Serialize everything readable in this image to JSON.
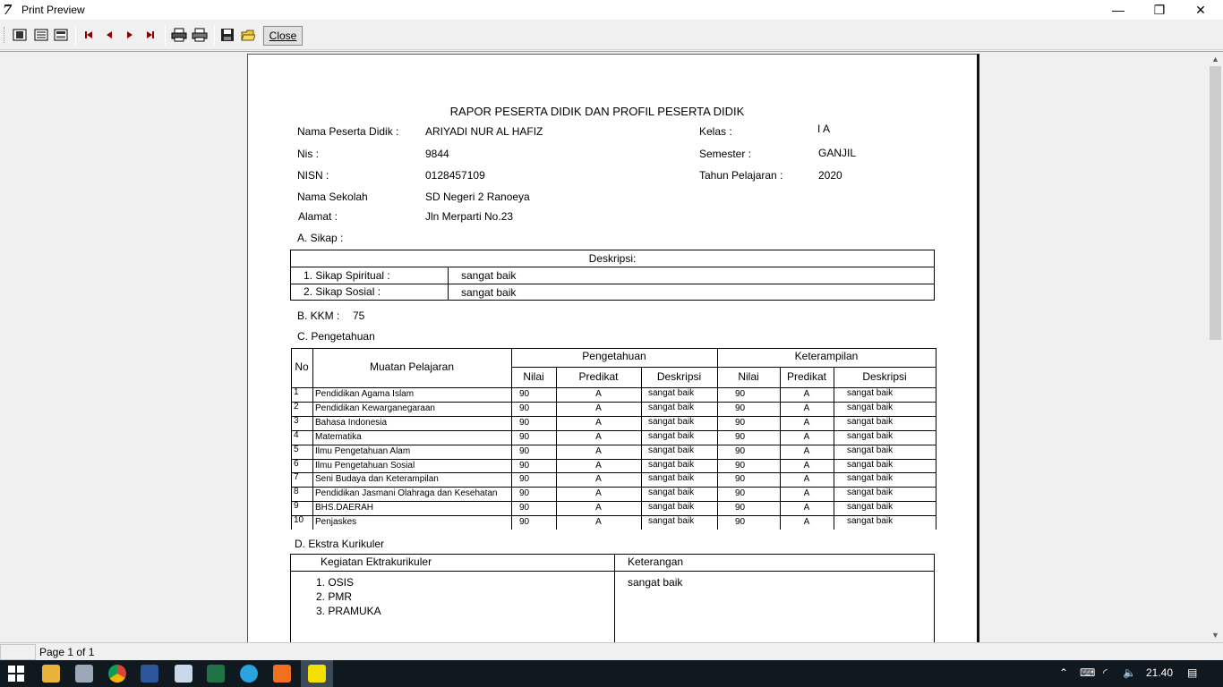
{
  "window": {
    "title": "Print Preview",
    "minimize": "—",
    "restore": "❐",
    "close": "✕"
  },
  "toolbar": {
    "close_label": "Close"
  },
  "report": {
    "title": "RAPOR PESERTA DIDIK DAN PROFIL PESERTA DIDIK",
    "labels": {
      "nama": "Nama Peserta Didik :",
      "nis": "Nis :",
      "nisn": "NISN :",
      "sekolah": "Nama Sekolah",
      "alamat": "Alamat :",
      "kelas": "Kelas :",
      "semester": "Semester :",
      "tahun": "Tahun Pelajaran :"
    },
    "values": {
      "nama": "ARIYADI NUR AL HAFIZ",
      "nis": "9844",
      "nisn": "0128457109",
      "sekolah": "SD Negeri 2 Ranoeya",
      "alamat": "Jln Merparti No.23",
      "kelas": "I A",
      "semester": "GANJIL",
      "tahun": "2020"
    },
    "sikap": {
      "heading": "A. Sikap :",
      "table_header": "Deskripsi:",
      "rows": [
        {
          "label": "1. Sikap Spiritual :",
          "value": "sangat baik"
        },
        {
          "label": "2. Sikap Sosial :",
          "value": "sangat baik"
        }
      ]
    },
    "kkm": {
      "label": "B. KKM :",
      "value": "75"
    },
    "pengetahuan": {
      "heading": "C. Pengetahuan",
      "headers": {
        "no": "No",
        "muatan": "Muatan Pelajaran",
        "pengetahuan": "Pengetahuan",
        "keterampilan": "Keterampilan",
        "nilai": "Nilai",
        "predikat": "Predikat",
        "deskripsi": "Deskripsi"
      },
      "rows": [
        {
          "no": "1",
          "mapel": "Pendidikan Agama Islam",
          "n1": "90",
          "p1": "A",
          "d1": "sangat baik",
          "n2": "90",
          "p2": "A",
          "d2": "sangat baik"
        },
        {
          "no": "2",
          "mapel": "Pendidikan Kewarganegaraan",
          "n1": "90",
          "p1": "A",
          "d1": "sangat baik",
          "n2": "90",
          "p2": "A",
          "d2": "sangat baik"
        },
        {
          "no": "3",
          "mapel": "Bahasa Indonesia",
          "n1": "90",
          "p1": "A",
          "d1": "sangat baik",
          "n2": "90",
          "p2": "A",
          "d2": "sangat baik"
        },
        {
          "no": "4",
          "mapel": "Matematika",
          "n1": "90",
          "p1": "A",
          "d1": "sangat baik",
          "n2": "90",
          "p2": "A",
          "d2": "sangat baik"
        },
        {
          "no": "5",
          "mapel": "Ilmu Pengetahuan Alam",
          "n1": "90",
          "p1": "A",
          "d1": "sangat baik",
          "n2": "90",
          "p2": "A",
          "d2": "sangat baik"
        },
        {
          "no": "6",
          "mapel": "Ilmu Pengetahuan Sosial",
          "n1": "90",
          "p1": "A",
          "d1": "sangat baik",
          "n2": "90",
          "p2": "A",
          "d2": "sangat baik"
        },
        {
          "no": "7",
          "mapel": "Seni Budaya dan Keterampilan",
          "n1": "90",
          "p1": "A",
          "d1": "sangat baik",
          "n2": "90",
          "p2": "A",
          "d2": "sangat baik"
        },
        {
          "no": "8",
          "mapel": "Pendidikan Jasmani Olahraga dan Kesehatan",
          "n1": "90",
          "p1": "A",
          "d1": "sangat baik",
          "n2": "90",
          "p2": "A",
          "d2": "sangat baik"
        },
        {
          "no": "9",
          "mapel": "BHS.DAERAH",
          "n1": "90",
          "p1": "A",
          "d1": "sangat baik",
          "n2": "90",
          "p2": "A",
          "d2": "sangat baik"
        },
        {
          "no": "10",
          "mapel": "Penjaskes",
          "n1": "90",
          "p1": "A",
          "d1": "sangat baik",
          "n2": "90",
          "p2": "A",
          "d2": "sangat baik"
        }
      ]
    },
    "ekstra": {
      "heading": "D. Ekstra Kurikuler",
      "col1": "Kegiatan Ektrakurikuler",
      "col2": "Keterangan",
      "items": [
        "1. OSIS",
        "2. PMR",
        "3. PRAMUKA"
      ],
      "keterangan": "sangat baik"
    }
  },
  "status": {
    "page": "Page 1 of 1"
  },
  "taskbar": {
    "time": "21.40"
  }
}
